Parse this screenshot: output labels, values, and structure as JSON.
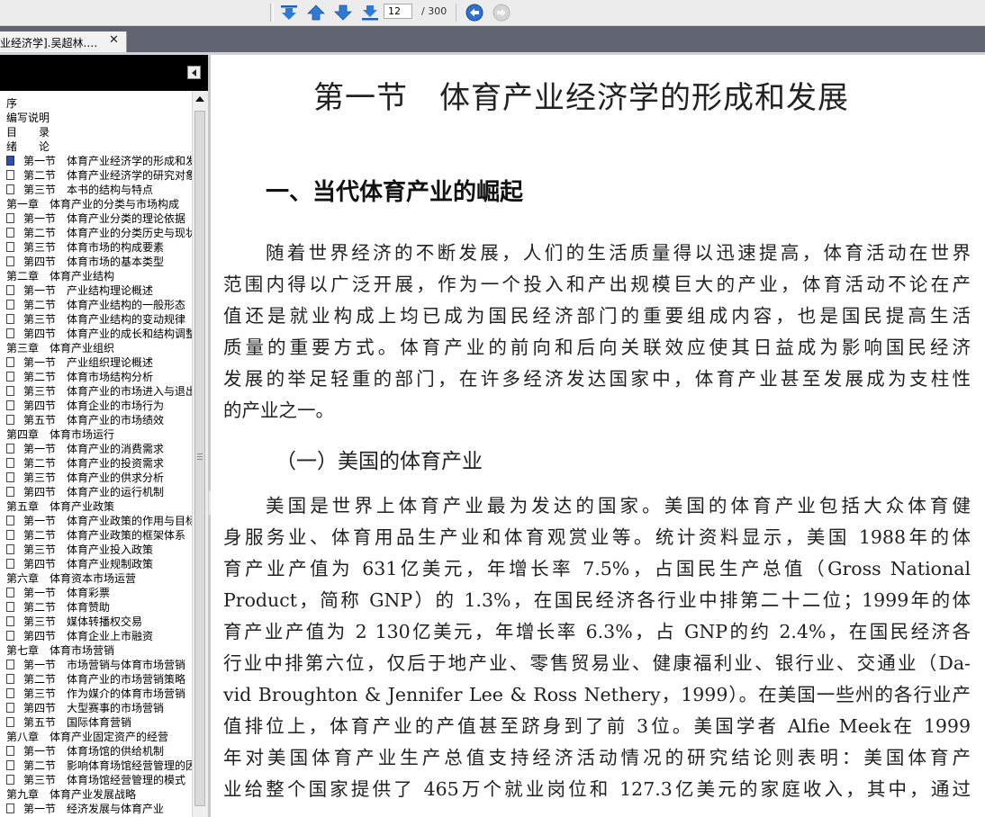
{
  "toolbar": {
    "first_page_icon": "first-page-icon",
    "prev_page_icon": "prev-page-icon",
    "next_page_icon": "next-page-icon",
    "last_page_icon": "last-page-icon",
    "page_current": "12",
    "page_total": "/ 300",
    "back_icon": "back-icon",
    "forward_icon": "forward-icon"
  },
  "tab": {
    "title": "业经济学].吴超林.…",
    "close": "✕"
  },
  "sidebar": {
    "bookmarks": [
      {
        "label": "序",
        "level": 0
      },
      {
        "label": "编写说明",
        "level": 0
      },
      {
        "label": "目　　录",
        "level": 0
      },
      {
        "label": "绪　　论",
        "level": 0
      },
      {
        "label": "第一节　体育产业经济学的形成和发展",
        "level": 1,
        "current": true
      },
      {
        "label": "第二节　体育产业经济学的研究对象",
        "level": 1
      },
      {
        "label": "第三节　本书的结构与特点",
        "level": 1
      },
      {
        "label": "第一章　体育产业的分类与市场构成",
        "level": 0
      },
      {
        "label": "第一节　体育产业分类的理论依据",
        "level": 1
      },
      {
        "label": "第二节　体育产业的分类历史与现状",
        "level": 1
      },
      {
        "label": "第三节　体育市场的构成要素",
        "level": 1
      },
      {
        "label": "第四节　体育市场的基本类型",
        "level": 1
      },
      {
        "label": "第二章　体育产业结构",
        "level": 0
      },
      {
        "label": "第一节　产业结构理论概述",
        "level": 1
      },
      {
        "label": "第二节　体育产业结构的一般形态",
        "level": 1
      },
      {
        "label": "第三节　体育产业结构的变动规律",
        "level": 1
      },
      {
        "label": "第四节　体育产业的成长和结构调整",
        "level": 1
      },
      {
        "label": "第三章　体育产业组织",
        "level": 0
      },
      {
        "label": "第一节　产业组织理论概述",
        "level": 1
      },
      {
        "label": "第二节　体育市场结构分析",
        "level": 1
      },
      {
        "label": "第三节　体育产业的市场进入与退出",
        "level": 1
      },
      {
        "label": "第四节　体育企业的市场行为",
        "level": 1
      },
      {
        "label": "第五节　体育产业的市场绩效",
        "level": 1
      },
      {
        "label": "第四章　体育市场运行",
        "level": 0
      },
      {
        "label": "第一节　体育产业的消费需求",
        "level": 1
      },
      {
        "label": "第二节　体育产业的投资需求",
        "level": 1
      },
      {
        "label": "第三节　体育产业的供求分析",
        "level": 1
      },
      {
        "label": "第四节　体育产业的运行机制",
        "level": 1
      },
      {
        "label": "第五章　体育产业政策",
        "level": 0
      },
      {
        "label": "第一节　体育产业政策的作用与目标",
        "level": 1
      },
      {
        "label": "第二节　体育产业政策的框架体系",
        "level": 1
      },
      {
        "label": "第三节　体育产业投入政策",
        "level": 1
      },
      {
        "label": "第四节　体育产业规制政策",
        "level": 1
      },
      {
        "label": "第六章　体育资本市场运营",
        "level": 0
      },
      {
        "label": "第一节　体育彩票",
        "level": 1
      },
      {
        "label": "第二节　体育赞助",
        "level": 1
      },
      {
        "label": "第三节　媒体转播权交易",
        "level": 1
      },
      {
        "label": "第四节　体育企业上市融资",
        "level": 1
      },
      {
        "label": "第七章　体育市场营销",
        "level": 0
      },
      {
        "label": "第一节　市场营销与体育市场营销",
        "level": 1
      },
      {
        "label": "第二节　体育产业的市场营销策略",
        "level": 1
      },
      {
        "label": "第三节　作为媒介的体育市场营销",
        "level": 1
      },
      {
        "label": "第四节　大型赛事的市场营销",
        "level": 1
      },
      {
        "label": "第五节　国际体育营销",
        "level": 1
      },
      {
        "label": "第八章　体育产业固定资产的经营",
        "level": 0
      },
      {
        "label": "第一节　体育场馆的供给机制",
        "level": 1
      },
      {
        "label": "第二节　影响体育场馆经营管理的因素",
        "level": 1
      },
      {
        "label": "第三节　体育场馆经营管理的模式",
        "level": 1
      },
      {
        "label": "第九章　体育产业发展战略",
        "level": 0
      },
      {
        "label": "第一节　经济发展与体育产业",
        "level": 1
      }
    ]
  },
  "document": {
    "title": "第一节　体育产业经济学的形成和发展",
    "heading1": "一、当代体育产业的崛起",
    "para1": [
      "随着世界经济的不断发展，人们的生活质量得以迅速提高，体育活动在世界",
      "范围内得以广泛开展，作为一个投入和产出规模巨大的产业，体育活动不论在产",
      "值还是就业构成上均已成为国民经济部门的重要组成内容，也是国民提高生活",
      "质量的重要方式。体育产业的前向和后向关联效应使其日益成为影响国民经济",
      "发展的举足轻重的部门，在许多经济发达国家中，体育产业甚至发展成为支柱性",
      "的产业之一。"
    ],
    "heading2": "（一）美国的体育产业",
    "para2": [
      "美国是世界上体育产业最为发达的国家。美国的体育产业包括大众体育健",
      "身服务业、体育用品生产业和体育观赏业等。统计资料显示，美国 1988年的体",
      "育产业产值为 631亿美元，年增长率 7.5%，占国民生产总值（Gross National",
      "Product，简称 GNP）的 1.3%，在国民经济各行业中排第二十二位；1999年的体",
      "育产业产值为 2 130亿美元，年增长率 6.3%，占 GNP的约 2.4%，在国民经济各",
      "行业中排第六位，仅后于地产业、零售贸易业、健康福利业、银行业、交通业（Da-",
      "vid Broughton & Jennifer Lee & Ross Nethery，1999）。在美国一些州的各行业产",
      "值排位上，体育产业的产值甚至跻身到了前 3位。美国学者 Alfie Meek在 1999",
      "年对美国体育产业生产总值支持经济活动情况的研究结论则表明：美国体育产",
      "业给整个国家提供了 465万个就业岗位和 127.3亿美元的家庭收入，其中，通过"
    ]
  }
}
